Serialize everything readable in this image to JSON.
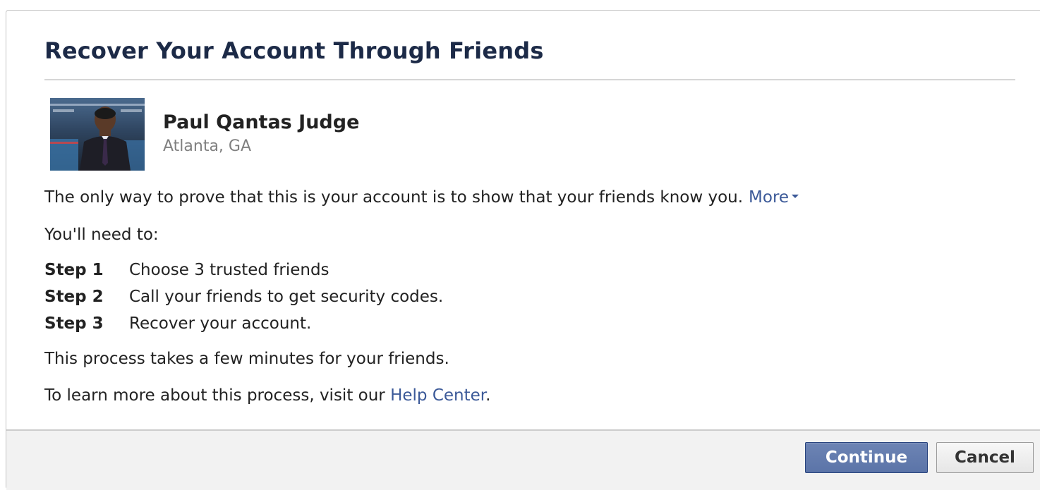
{
  "dialog": {
    "title": "Recover Your Account Through Friends"
  },
  "profile": {
    "name": "Paul Qantas Judge",
    "location": "Atlanta, GA"
  },
  "body": {
    "intro": "The only way to prove that this is your account is to show that your friends know you.",
    "more_link": "More",
    "need_to": "You'll need to:",
    "steps": [
      {
        "label": "Step 1",
        "text": "Choose 3 trusted friends"
      },
      {
        "label": "Step 2",
        "text": "Call your friends to get security codes."
      },
      {
        "label": "Step 3",
        "text": "Recover your account."
      }
    ],
    "process_note": "This process takes a few minutes for your friends.",
    "learn_prefix": "To learn more about this process, visit our",
    "help_link": "Help Center",
    "learn_suffix": "."
  },
  "footer": {
    "continue_label": "Continue",
    "cancel_label": "Cancel"
  },
  "colors": {
    "title": "#1c2a47",
    "link": "#3b5998",
    "primary_button": "#5b74a8",
    "footer_bg": "#f2f2f2"
  },
  "icons": {
    "more_caret": "caret-down-icon"
  }
}
